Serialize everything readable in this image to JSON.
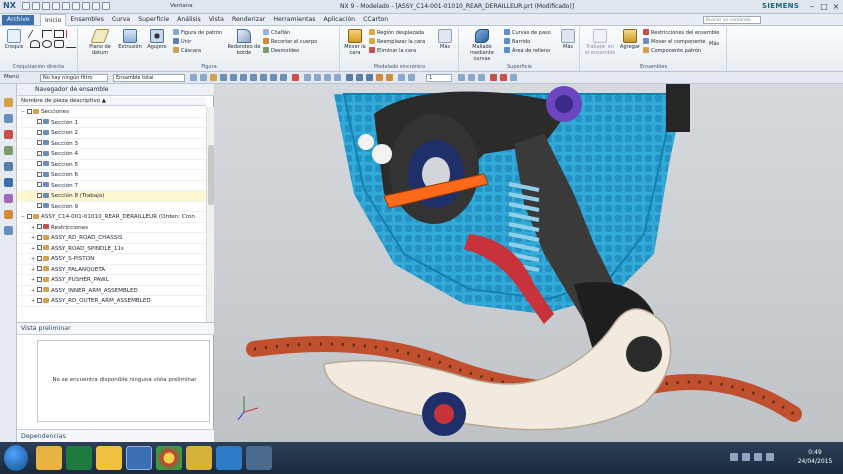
{
  "titlebar": {
    "app": "NX",
    "window_menu": "Ventana",
    "title": "NX 9 - Modelado - [ASSY_C14-001-01010_REAR_DERAILLEUR.prt (Modificado)]",
    "brand": "SIEMENS"
  },
  "menubar": {
    "file": "Archivo",
    "items": [
      "Inicio",
      "Ensambles",
      "Curva",
      "Superficie",
      "Análisis",
      "Vista",
      "Renderizar",
      "Herramientas",
      "Aplicación",
      "CCarton"
    ],
    "active": "Inicio",
    "search_placeholder": "Buscar un comando"
  },
  "ribbon": {
    "groups": [
      {
        "label": "Croquización directa",
        "big": [
          {
            "label": "Croquis"
          }
        ]
      },
      {
        "label": "Figura",
        "big": [
          {
            "label": "Plano de datum"
          },
          {
            "label": "Extrusión"
          },
          {
            "label": "Agujero"
          },
          {
            "label": "Redondeo de borde"
          }
        ],
        "small": [
          "Figura de patrón",
          "Unir",
          "Cáscara",
          "Chaflán",
          "Recortar el cuerpo",
          "Desmoldeo"
        ]
      },
      {
        "label": "Modelado sincrónico",
        "big": [
          {
            "label": "Mover la cara"
          },
          {
            "label": "Más"
          }
        ],
        "small": [
          "Región desplazada",
          "Reemplazar la cara",
          "Eliminar la cara"
        ]
      },
      {
        "label": "Superficie",
        "big": [
          {
            "label": "Mallado mediante curvas"
          },
          {
            "label": "Más"
          }
        ],
        "small": [
          "Curvas de paso",
          "Barrido",
          "Área de relleno"
        ]
      },
      {
        "label": "Ensambles",
        "big": [
          {
            "label": "Trabajar en el ensamble"
          },
          {
            "label": "Agregar"
          },
          {
            "label": "Más"
          }
        ],
        "small": [
          "Restricciones del ensamble",
          "Mover el componente",
          "Componente patrón"
        ]
      }
    ]
  },
  "toolbar2": {
    "menu": "Menú",
    "filter": "No hay ningún filtro",
    "scope": "Ensamble total",
    "layer": "1"
  },
  "navigator": {
    "title": "Navegador de ensamble",
    "column": "Nombre de pieza descriptivo",
    "rows": [
      {
        "label": "Secciones",
        "indent": 0,
        "exp": "−",
        "type": "folder"
      },
      {
        "label": "Sección 1",
        "indent": 1,
        "type": "sec"
      },
      {
        "label": "Sección 2",
        "indent": 1,
        "type": "sec"
      },
      {
        "label": "Sección 3",
        "indent": 1,
        "type": "sec"
      },
      {
        "label": "Sección 4",
        "indent": 1,
        "type": "sec"
      },
      {
        "label": "Sección 5",
        "indent": 1,
        "type": "sec"
      },
      {
        "label": "Sección 6",
        "indent": 1,
        "type": "sec"
      },
      {
        "label": "Sección 7",
        "indent": 1,
        "type": "sec"
      },
      {
        "label": "Sección 8 (Trabajo)",
        "indent": 1,
        "type": "sec",
        "selected": true
      },
      {
        "label": "Sección 9",
        "indent": 1,
        "type": "sec"
      },
      {
        "label": "ASSY_C14-001-01010_REAR_DERAILLEUR (Orden: Cron",
        "indent": 0,
        "exp": "−",
        "type": "assy"
      },
      {
        "label": "Restricciones",
        "indent": 1,
        "exp": "+",
        "type": "cons"
      },
      {
        "label": "ASSY_RD_ROAD_CHASSIS",
        "indent": 1,
        "exp": "+",
        "type": "assy"
      },
      {
        "label": "ASSY_ROAD_SPINDLE_11s",
        "indent": 1,
        "exp": "+",
        "type": "assy"
      },
      {
        "label": "ASSY_S-PISTON",
        "indent": 1,
        "exp": "+",
        "type": "assy"
      },
      {
        "label": "ASSY_PALANQUETA",
        "indent": 1,
        "exp": "+",
        "type": "assy"
      },
      {
        "label": "ASSY_PUSHER_PAWL",
        "indent": 1,
        "exp": "+",
        "type": "assy"
      },
      {
        "label": "ASSY_INNER_ARM_ASSEMBLED",
        "indent": 1,
        "exp": "+",
        "type": "assy"
      },
      {
        "label": "ASSY_RD_OUTER_ARM_ASSEMBLED",
        "indent": 1,
        "exp": "+",
        "type": "assy"
      }
    ]
  },
  "preview": {
    "title": "Vista preliminar",
    "message": "No se encuentra disponible ninguna vista preliminar",
    "deps": "Dependencias"
  },
  "taskbar": {
    "time": "0:49",
    "date": "24/04/2015"
  },
  "colors": {
    "accent": "#3d6fad",
    "cassette": "#2aa8d8",
    "chain": "#c0502e",
    "spring": "#8fd0e8",
    "arm_red": "#c8323a",
    "piston": "#ff6a1a",
    "jockey": "#f2eadf"
  }
}
